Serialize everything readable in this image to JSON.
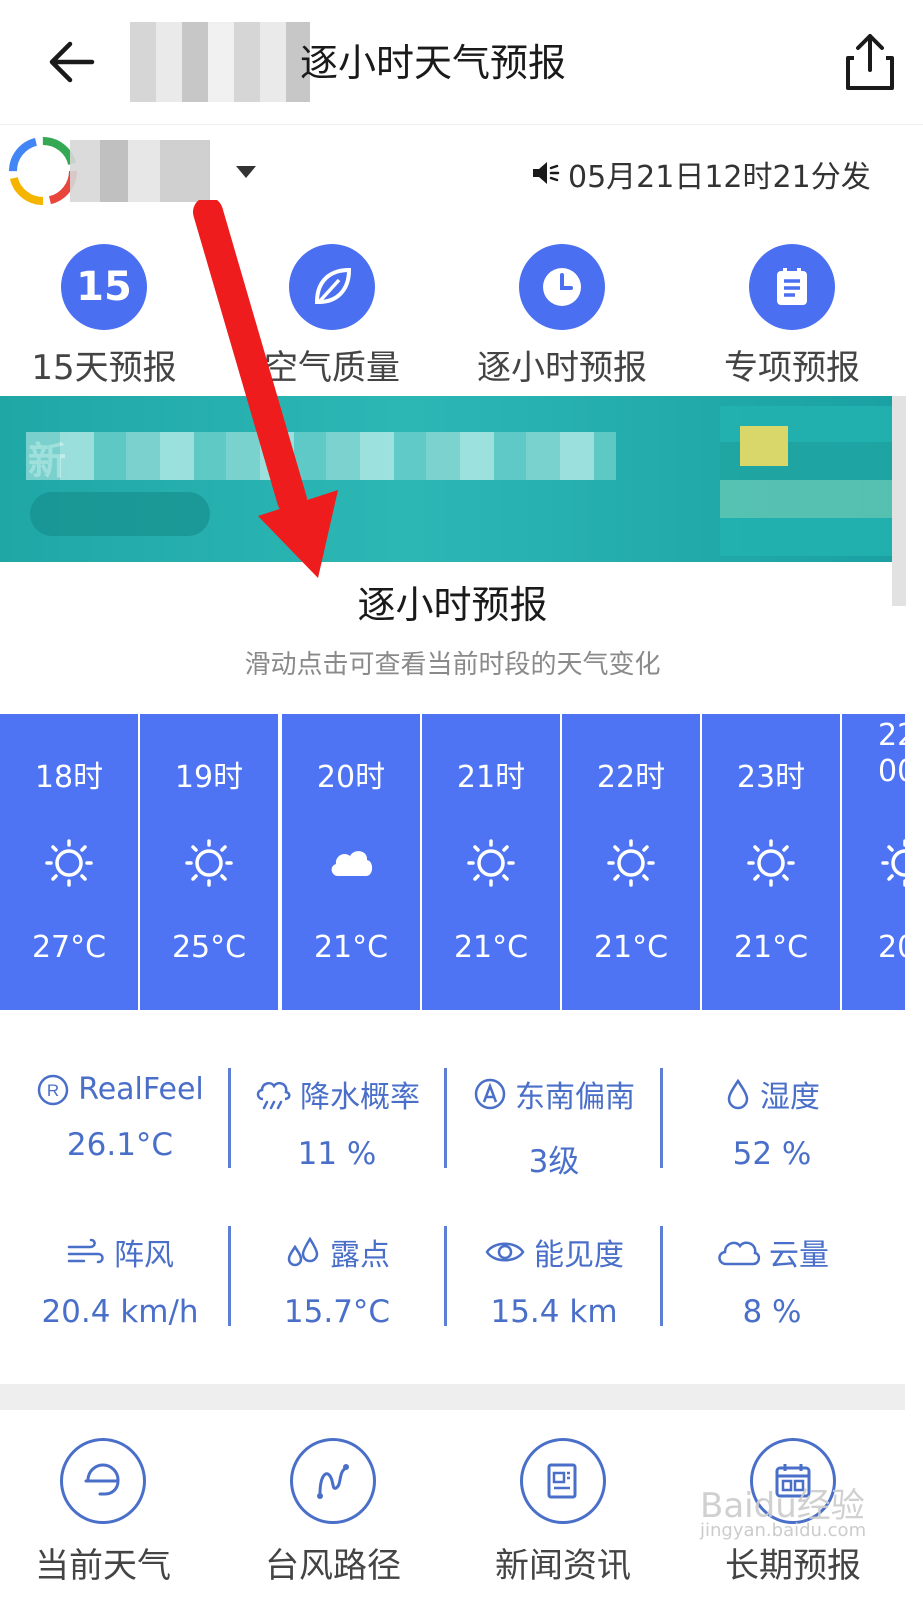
{
  "header": {
    "title": "逐小时天气预报"
  },
  "location": {
    "publish_time": "05月21日12时21分发"
  },
  "quick_menu": [
    {
      "label": "15天预报",
      "badge": "15",
      "icon": "calendar-15-icon"
    },
    {
      "label": "空气质量",
      "icon": "leaf-icon"
    },
    {
      "label": "逐小时预报",
      "icon": "clock-icon"
    },
    {
      "label": "专项预报",
      "icon": "clipboard-icon"
    }
  ],
  "banner": {
    "text_start": "新"
  },
  "section": {
    "title": "逐小时预报",
    "subtitle": "滑动点击可查看当前时段的天气变化"
  },
  "hourly": [
    {
      "hour": "18时",
      "icon": "sun-icon",
      "temp": "27°C"
    },
    {
      "hour": "19时",
      "icon": "sun-icon",
      "temp": "25°C"
    },
    {
      "hour": "20时",
      "icon": "cloud-icon",
      "temp": "21°C"
    },
    {
      "hour": "21时",
      "icon": "sun-icon",
      "temp": "21°C"
    },
    {
      "hour": "22时",
      "icon": "sun-icon",
      "temp": "21°C"
    },
    {
      "hour": "23时",
      "icon": "sun-icon",
      "temp": "21°C"
    },
    {
      "hour": "22",
      "hour2": "00",
      "icon": "sun-icon",
      "temp": "20"
    }
  ],
  "details": [
    {
      "label": "RealFeel",
      "value": "26.1°C",
      "icon": "realfeel-icon"
    },
    {
      "label": "降水概率",
      "value": "11 %",
      "icon": "rain-cloud-icon"
    },
    {
      "label": "东南偏南",
      "value": "3级",
      "icon": "wind-direction-icon"
    },
    {
      "label": "湿度",
      "value": "52 %",
      "icon": "droplet-icon"
    },
    {
      "label": "阵风",
      "value": "20.4 km/h",
      "icon": "gust-icon"
    },
    {
      "label": "露点",
      "value": "15.7°C",
      "icon": "dewpoint-icon"
    },
    {
      "label": "能见度",
      "value": "15.4 km",
      "icon": "eye-icon"
    },
    {
      "label": "云量",
      "value": "8 %",
      "icon": "cloud-outline-icon"
    }
  ],
  "bottom_menu": [
    {
      "label": "当前天气",
      "icon": "current-weather-icon"
    },
    {
      "label": "台风路径",
      "icon": "typhoon-path-icon"
    },
    {
      "label": "新闻资讯",
      "icon": "news-icon"
    },
    {
      "label": "长期预报",
      "icon": "calendar-icon"
    }
  ],
  "watermark": {
    "text": "Baidu经验",
    "sub": "jingyan.baidu.com"
  },
  "colors": {
    "accent": "#4e74f4",
    "text_blue": "#4a6fc9",
    "banner": "#1fa7a6",
    "arrow": "#ee1c1c"
  }
}
